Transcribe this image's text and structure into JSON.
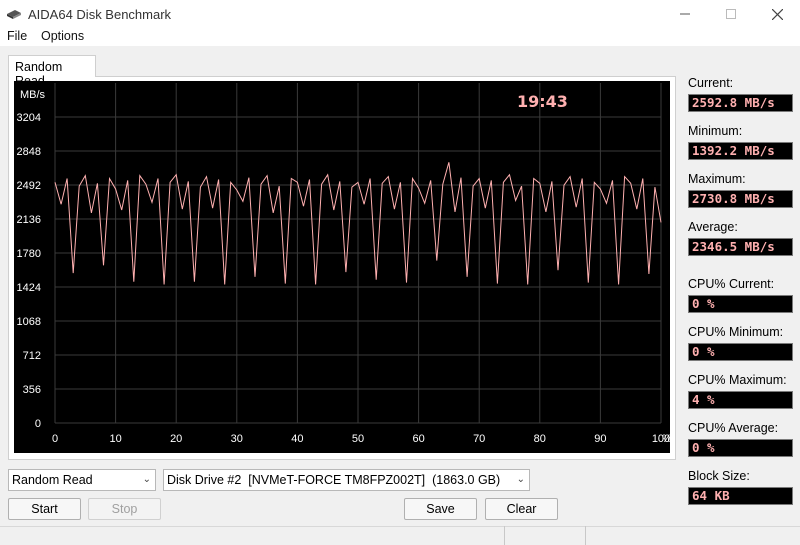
{
  "window": {
    "title": "AIDA64 Disk Benchmark",
    "controls": [
      "minimize",
      "maximize",
      "close"
    ]
  },
  "menu": {
    "items": [
      "File",
      "Options"
    ]
  },
  "tab": {
    "label": "Random Read"
  },
  "chart_data": {
    "type": "line",
    "title": "",
    "clock": "19:43",
    "ylabel": "MB/s",
    "xlabel": "",
    "x_unit": "%",
    "yticks": [
      0,
      356,
      712,
      1068,
      1424,
      1780,
      2136,
      2492,
      2848,
      3204
    ],
    "xticks": [
      0,
      10,
      20,
      30,
      40,
      50,
      60,
      70,
      80,
      90,
      100
    ],
    "ylim": [
      0,
      3560
    ],
    "xlim": [
      0,
      100
    ],
    "grid": true,
    "line_color": "#ffb0b0",
    "series": [
      {
        "x": [
          0,
          1,
          2,
          3,
          4,
          5,
          6,
          7,
          8,
          9,
          10,
          11,
          12,
          13,
          14,
          15,
          16,
          17,
          18,
          19,
          20,
          21,
          22,
          23,
          24,
          25,
          26,
          27,
          28,
          29,
          30,
          31,
          32,
          33,
          34,
          35,
          36,
          37,
          38,
          39,
          40,
          41,
          42,
          43,
          44,
          45,
          46,
          47,
          48,
          49,
          50,
          51,
          52,
          53,
          54,
          55,
          56,
          57,
          58,
          59,
          60,
          61,
          62,
          63,
          64,
          65,
          66,
          67,
          68,
          69,
          70,
          71,
          72,
          73,
          74,
          75,
          76,
          77,
          78,
          79,
          80,
          81,
          82,
          83,
          84,
          85,
          86,
          87,
          88,
          89,
          90,
          91,
          92,
          93,
          94,
          95,
          96,
          97,
          98,
          99,
          100
        ],
        "values": [
          2520,
          2290,
          2560,
          1570,
          2480,
          2590,
          2200,
          2510,
          1650,
          2560,
          2450,
          2230,
          2540,
          1480,
          2590,
          2500,
          2310,
          2560,
          1450,
          2520,
          2600,
          2240,
          2530,
          1480,
          2470,
          2580,
          2250,
          2550,
          1450,
          2520,
          2440,
          2320,
          2570,
          1530,
          2500,
          2590,
          2200,
          2480,
          1460,
          2560,
          2520,
          2270,
          2550,
          1450,
          2500,
          2600,
          2230,
          2530,
          1580,
          2470,
          2520,
          2290,
          2560,
          1500,
          2510,
          2580,
          2240,
          2520,
          1470,
          2560,
          2460,
          2300,
          2540,
          1700,
          2500,
          2730,
          2210,
          2570,
          1530,
          2480,
          2560,
          2250,
          2540,
          1460,
          2520,
          2600,
          2330,
          2480,
          1450,
          2560,
          2510,
          2210,
          2530,
          1600,
          2490,
          2580,
          2260,
          2560,
          1470,
          2520,
          2450,
          2300,
          2540,
          1450,
          2580,
          2510,
          2240,
          2560,
          1560,
          2470,
          2100
        ]
      }
    ]
  },
  "stats": {
    "current": {
      "label": "Current:",
      "value": "2592.8 MB/s"
    },
    "minimum": {
      "label": "Minimum:",
      "value": "1392.2 MB/s"
    },
    "maximum": {
      "label": "Maximum:",
      "value": "2730.8 MB/s"
    },
    "average": {
      "label": "Average:",
      "value": "2346.5 MB/s"
    },
    "cpu_current": {
      "label": "CPU% Current:",
      "value": "0 %"
    },
    "cpu_minimum": {
      "label": "CPU% Minimum:",
      "value": "0 %"
    },
    "cpu_maximum": {
      "label": "CPU% Maximum:",
      "value": "4 %"
    },
    "cpu_average": {
      "label": "CPU% Average:",
      "value": "0 %"
    },
    "block_size": {
      "label": "Block Size:",
      "value": "64 KB"
    }
  },
  "controls": {
    "test_select": "Random Read",
    "drive_select": "Disk Drive #2  [NVMeT-FORCE TM8FPZ002T]  (1863.0 GB)",
    "start_label": "Start",
    "stop_label": "Stop",
    "save_label": "Save",
    "clear_label": "Clear"
  }
}
